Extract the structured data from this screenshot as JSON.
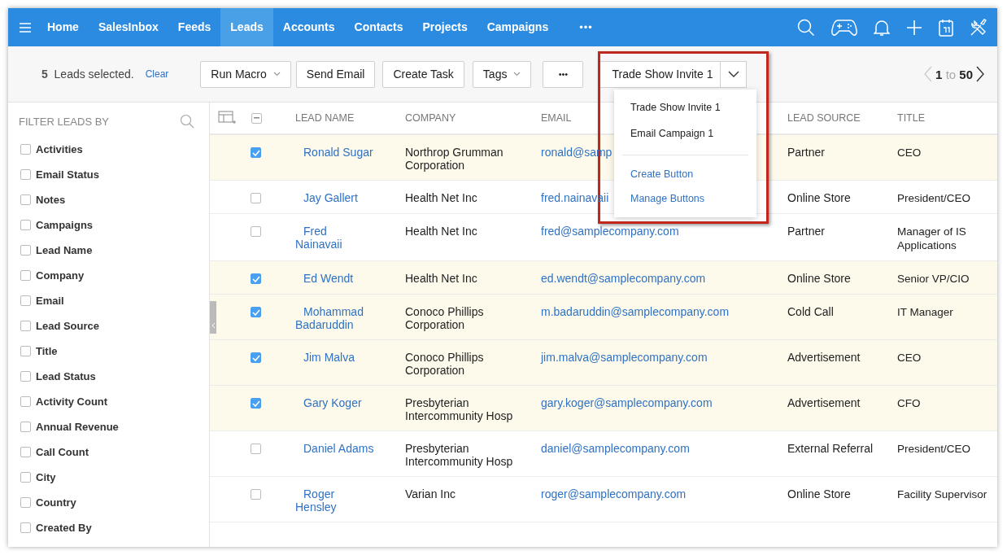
{
  "nav": {
    "items": [
      {
        "label": "Home",
        "selected": false
      },
      {
        "label": "SalesInbox",
        "selected": false
      },
      {
        "label": "Feeds",
        "selected": false
      },
      {
        "label": "Leads",
        "selected": true
      },
      {
        "label": "Accounts",
        "selected": false
      },
      {
        "label": "Contacts",
        "selected": false
      },
      {
        "label": "Projects",
        "selected": false
      },
      {
        "label": "Campaigns",
        "selected": false
      }
    ],
    "more": "•••"
  },
  "toolbar": {
    "count": "5",
    "selected_text": "Leads selected.",
    "clear": "Clear",
    "buttons": [
      {
        "label": "Run Macro",
        "kind": "dropdown"
      },
      {
        "label": "Send Email",
        "kind": "plain"
      },
      {
        "label": "Create Task",
        "kind": "plain"
      },
      {
        "label": "Tags",
        "kind": "dropdown"
      },
      {
        "label": "•••",
        "kind": "more"
      }
    ],
    "split_button": {
      "label": "Trade Show Invite 1"
    },
    "pagination": {
      "from": "1",
      "to_word": "to",
      "to": "50"
    }
  },
  "dropdown": {
    "items": [
      {
        "label": "Trade Show Invite 1",
        "kind": "option"
      },
      {
        "label": "Email Campaign 1",
        "kind": "option"
      },
      {
        "label": "Create Button",
        "kind": "action"
      },
      {
        "label": "Manage Buttons",
        "kind": "action"
      }
    ]
  },
  "sidebar": {
    "title": "FILTER LEADS BY",
    "filters": [
      {
        "label": "Activities",
        "checked": false
      },
      {
        "label": "Email Status",
        "checked": false
      },
      {
        "label": "Notes",
        "checked": false
      },
      {
        "label": "Campaigns",
        "checked": false
      },
      {
        "label": "Lead Name",
        "checked": false
      },
      {
        "label": "Company",
        "checked": false
      },
      {
        "label": "Email",
        "checked": false
      },
      {
        "label": "Lead Source",
        "checked": false
      },
      {
        "label": "Title",
        "checked": false
      },
      {
        "label": "Lead Status",
        "checked": false
      },
      {
        "label": "Activity Count",
        "checked": false
      },
      {
        "label": "Annual Revenue",
        "checked": false
      },
      {
        "label": "Call Count",
        "checked": false
      },
      {
        "label": "City",
        "checked": false
      },
      {
        "label": "Country",
        "checked": false
      },
      {
        "label": "Created By",
        "checked": false
      }
    ]
  },
  "table": {
    "header_checkbox": {
      "indeterminate": true
    },
    "columns": [
      "LEAD NAME",
      "COMPANY",
      "EMAIL",
      "LEAD SOURCE",
      "TITLE"
    ],
    "rows": [
      {
        "selected": true,
        "lead_name": "Ronald Sugar",
        "company": "Northrop Grumman Corporation",
        "email": "ronald@samp",
        "lead_source": "Partner",
        "title": "CEO"
      },
      {
        "selected": false,
        "lead_name": "Jay Gallert",
        "company": "Health Net Inc",
        "email": "fred.nainavaii",
        "lead_source": "Online Store",
        "title": "President/CEO"
      },
      {
        "selected": false,
        "lead_name": "Fred Nainavaii",
        "company": "Health Net Inc",
        "email": "fred@samplecompany.com",
        "lead_source": "Partner",
        "title": "Manager of IS Applications"
      },
      {
        "selected": true,
        "lead_name": "Ed Wendt",
        "company": "Health Net Inc",
        "email": "ed.wendt@samplecompany.com",
        "lead_source": "Online Store",
        "title": "Senior VP/CIO"
      },
      {
        "selected": true,
        "lead_name": "Mohammad Badaruddin",
        "company": "Conoco Phillips Corporation",
        "email": "m.badaruddin@samplecompany.com",
        "lead_source": "Cold Call",
        "title": "IT Manager"
      },
      {
        "selected": true,
        "lead_name": "Jim Malva",
        "company": "Conoco Phillips Corporation",
        "email": "jim.malva@samplecompany.com",
        "lead_source": "Advertisement",
        "title": "CEO"
      },
      {
        "selected": true,
        "lead_name": "Gary Koger",
        "company": "Presbyterian Intercommunity Hosp",
        "email": "gary.koger@samplecompany.com",
        "lead_source": "Advertisement",
        "title": "CFO"
      },
      {
        "selected": false,
        "lead_name": "Daniel Adams",
        "company": "Presbyterian Intercommunity Hosp",
        "email": "daniel@samplecompany.com",
        "lead_source": "External Referral",
        "title": "President/CEO"
      },
      {
        "selected": false,
        "lead_name": "Roger Hensley",
        "company": "Varian Inc",
        "email": "roger@samplecompany.com",
        "lead_source": "Online Store",
        "title": "Facility Supervisor"
      }
    ]
  }
}
